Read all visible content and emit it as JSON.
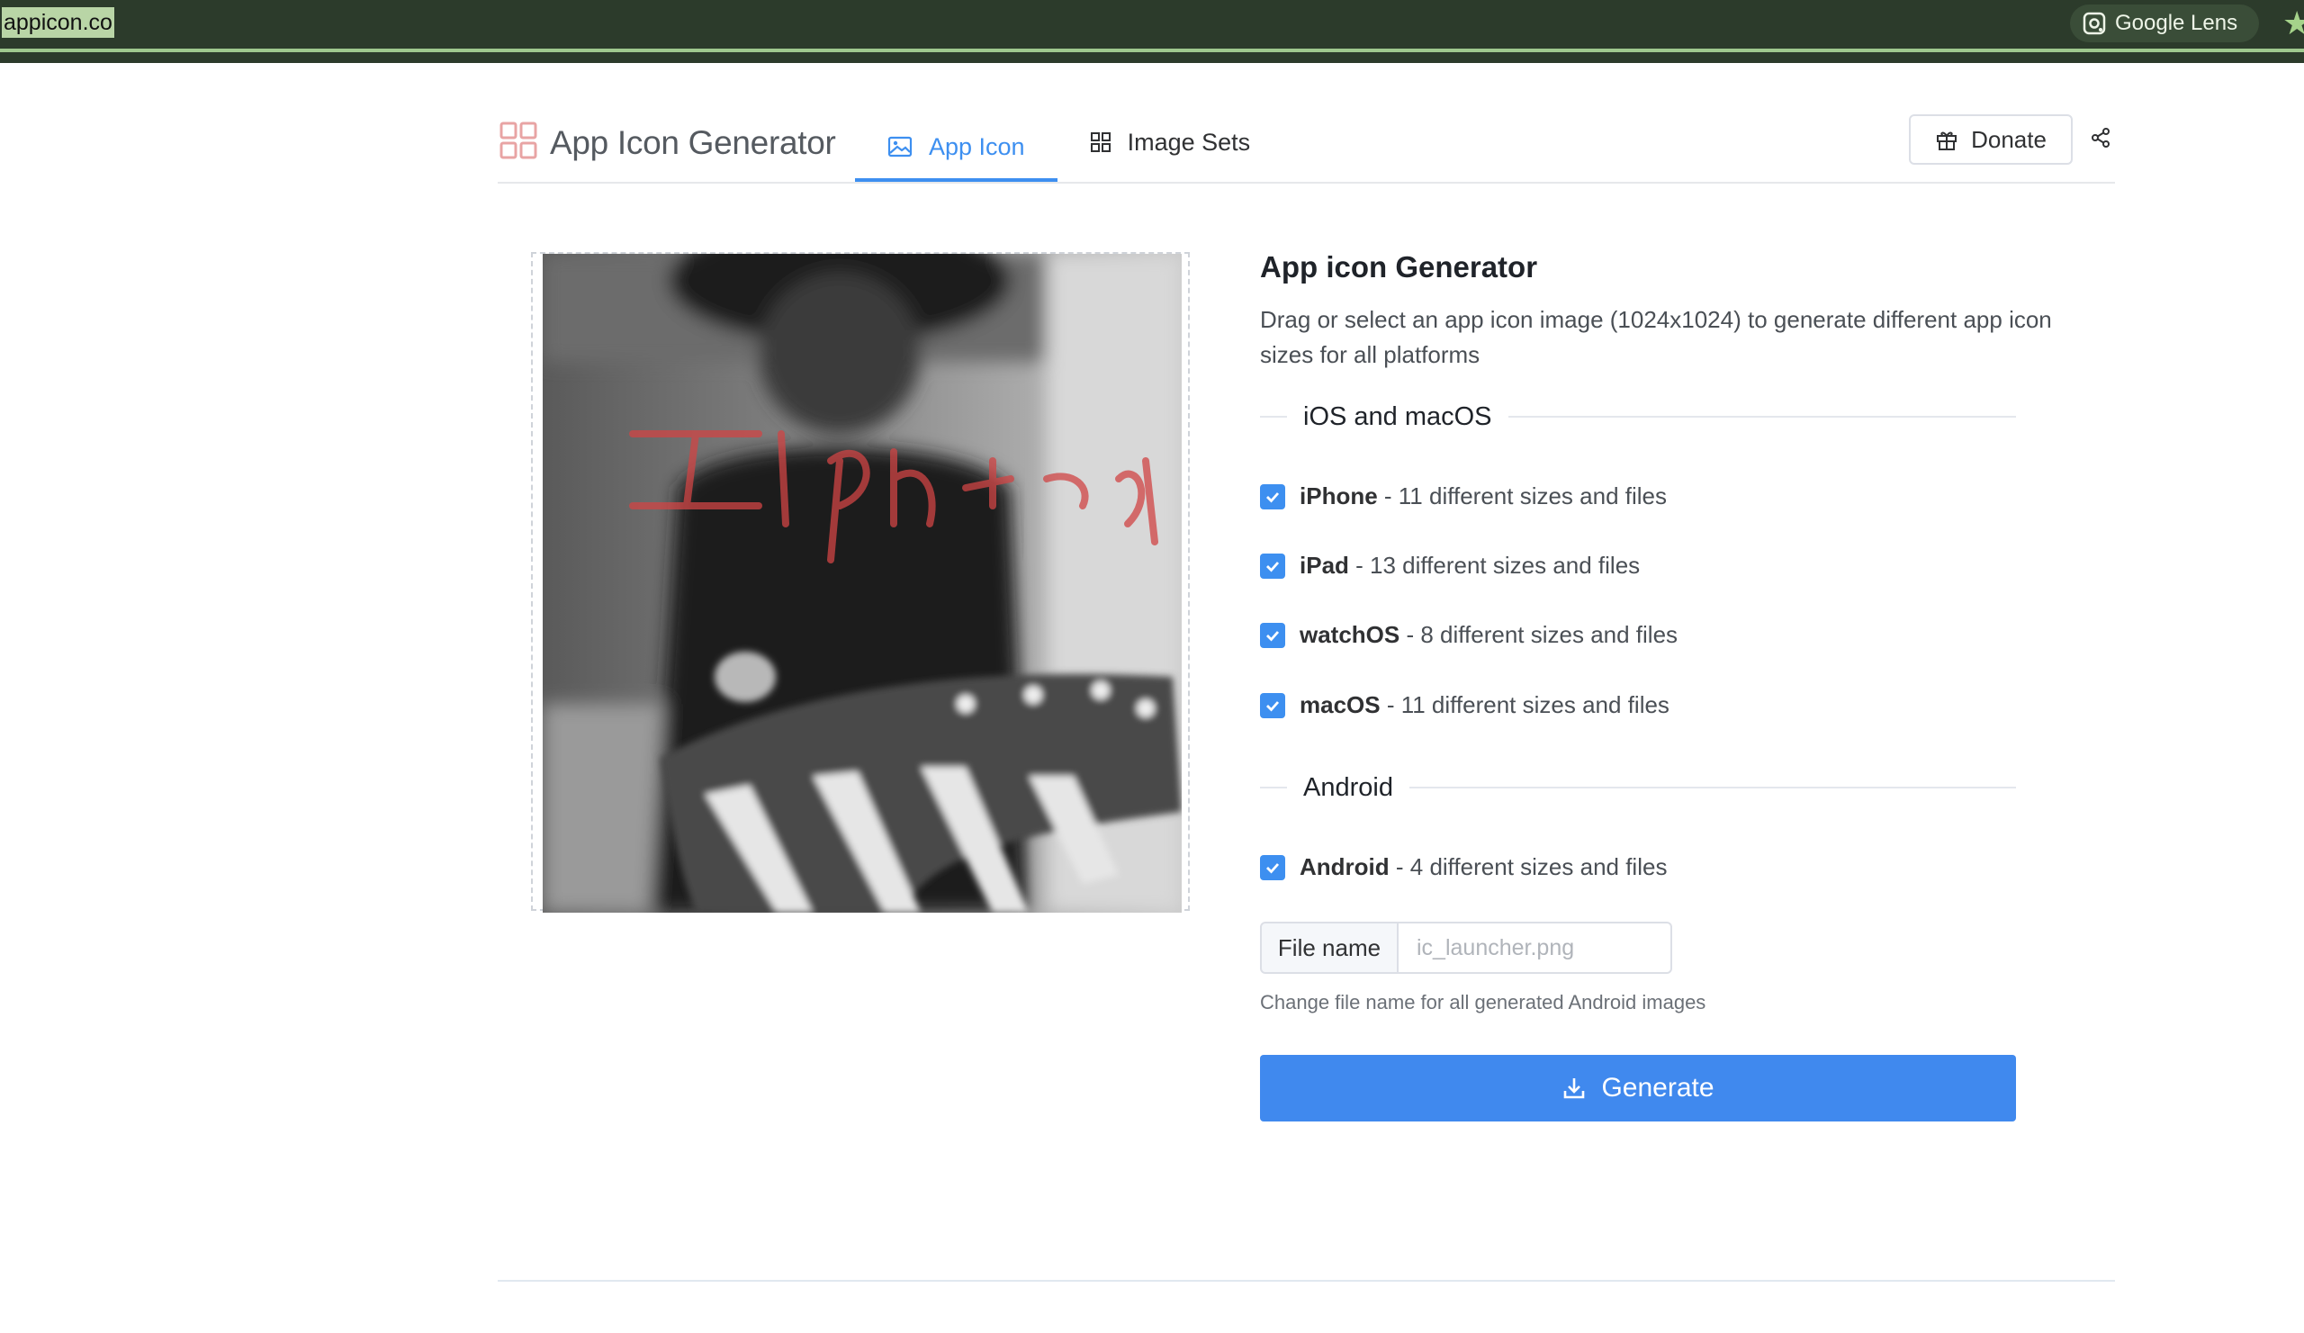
{
  "browser": {
    "url": "appicon.co",
    "lens_label": "Google Lens",
    "lens_icon": "camera-lens-icon",
    "bookmark_icon": "star-icon"
  },
  "header": {
    "brand_title": "App Icon Generator",
    "brand_icon": "grid-logo-icon",
    "tabs": [
      {
        "label": "App Icon",
        "icon": "image-icon",
        "active": true
      },
      {
        "label": "Image Sets",
        "icon": "grid-icon",
        "active": false
      }
    ],
    "donate_label": "Donate",
    "donate_icon": "gift-icon",
    "share_icon": "share-icon"
  },
  "main": {
    "title": "App icon Generator",
    "description": "Drag or select an app icon image (1024x1024) to generate different app icon sizes for all platforms",
    "sections": [
      {
        "title": "iOS and macOS",
        "options": [
          {
            "name": "iPhone",
            "detail": " - 11 different sizes and files",
            "checked": true
          },
          {
            "name": "iPad",
            "detail": " - 13 different sizes and files",
            "checked": true
          },
          {
            "name": "watchOS",
            "detail": " - 8 different sizes and files",
            "checked": true
          },
          {
            "name": "macOS",
            "detail": " - 11 different sizes and files",
            "checked": true
          }
        ]
      },
      {
        "title": "Android",
        "options": [
          {
            "name": "Android",
            "detail": " - 4 different sizes and files",
            "checked": true
          }
        ]
      }
    ],
    "file_name": {
      "label": "File name",
      "value": "",
      "placeholder": "ic_launcher.png",
      "hint": "Change file name for all generated Android images"
    },
    "generate_label": "Generate",
    "generate_icon": "download-icon"
  },
  "colors": {
    "accent": "#4089ee",
    "browser_bar": "#2c3b2b",
    "logo_red": "#e8a4a4"
  }
}
